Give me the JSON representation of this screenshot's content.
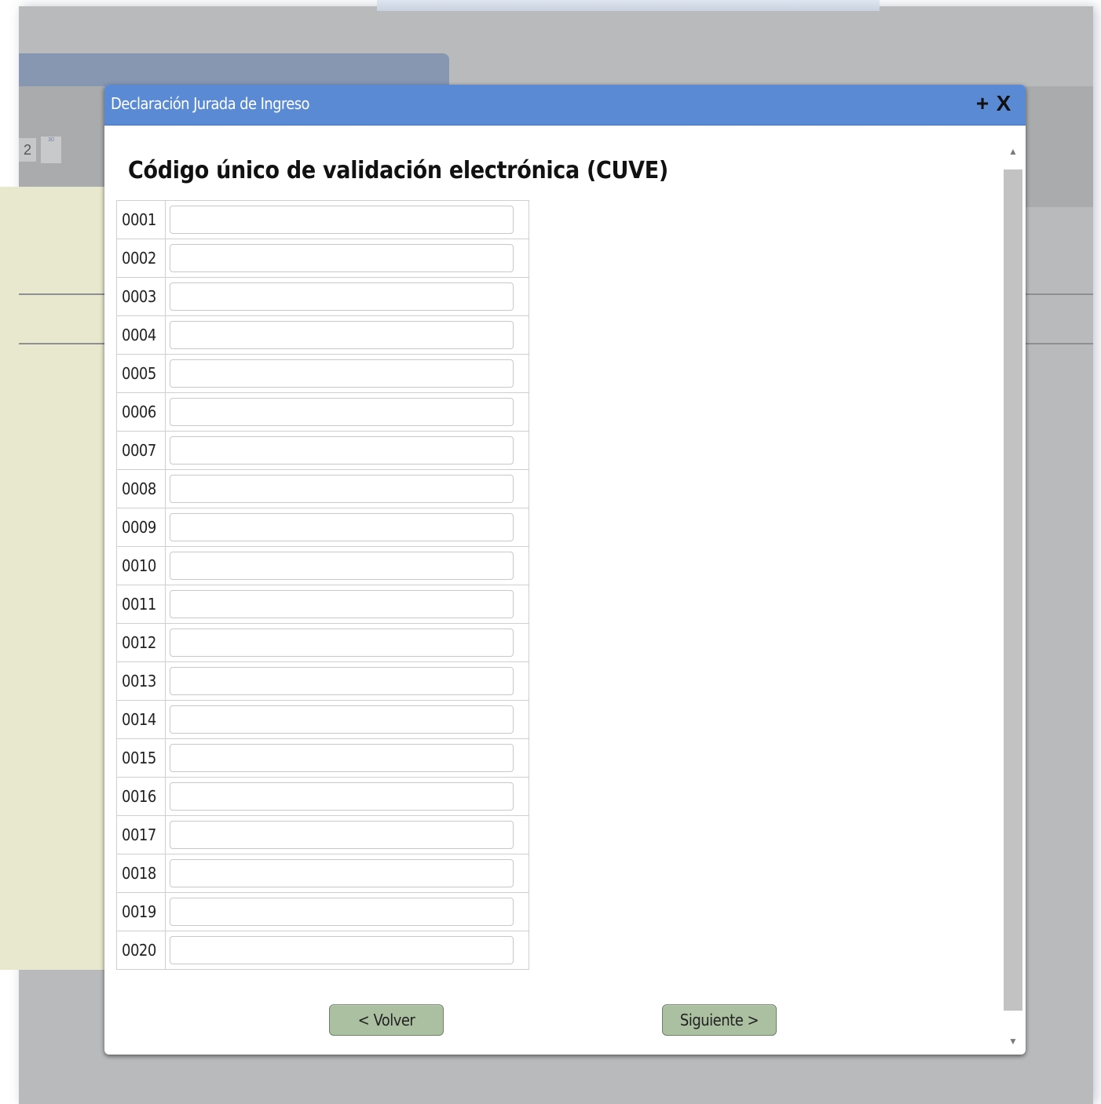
{
  "background": {
    "page_number": "2",
    "mini_badge": "30"
  },
  "dialog": {
    "title": "Declaración Jurada de Ingreso",
    "maximize_symbol": "+",
    "close_symbol": "X",
    "heading": "Código único de validación electrónica (CUVE)"
  },
  "cuve_rows": [
    {
      "number": "0001",
      "value": "",
      "placeholder": ""
    },
    {
      "number": "0002",
      "value": "",
      "placeholder": ""
    },
    {
      "number": "0003",
      "value": "",
      "placeholder": ""
    },
    {
      "number": "0004",
      "value": "",
      "placeholder": ""
    },
    {
      "number": "0005",
      "value": "",
      "placeholder": ""
    },
    {
      "number": "0006",
      "value": "",
      "placeholder": ""
    },
    {
      "number": "0007",
      "value": "",
      "placeholder": ""
    },
    {
      "number": "0008",
      "value": "",
      "placeholder": ""
    },
    {
      "number": "0009",
      "value": "",
      "placeholder": ""
    },
    {
      "number": "0010",
      "value": "",
      "placeholder": ""
    },
    {
      "number": "0011",
      "value": "",
      "placeholder": ""
    },
    {
      "number": "0012",
      "value": "",
      "placeholder": ""
    },
    {
      "number": "0013",
      "value": "",
      "placeholder": ""
    },
    {
      "number": "0014",
      "value": "",
      "placeholder": ""
    },
    {
      "number": "0015",
      "value": "",
      "placeholder": ""
    },
    {
      "number": "0016",
      "value": "",
      "placeholder": ""
    },
    {
      "number": "0017",
      "value": "",
      "placeholder": ""
    },
    {
      "number": "0018",
      "value": "",
      "placeholder": ""
    },
    {
      "number": "0019",
      "value": "",
      "placeholder": ""
    },
    {
      "number": "0020",
      "value": "",
      "placeholder": ""
    }
  ],
  "buttons": {
    "back_label": "< Volver",
    "next_label": "Siguiente >"
  },
  "scrollbar": {
    "up_icon": "▲",
    "down_icon": "▼"
  },
  "colors": {
    "titlebar": "#5b8ad4",
    "button_fill": "#aac0a0",
    "overlay": "#b9babc"
  }
}
